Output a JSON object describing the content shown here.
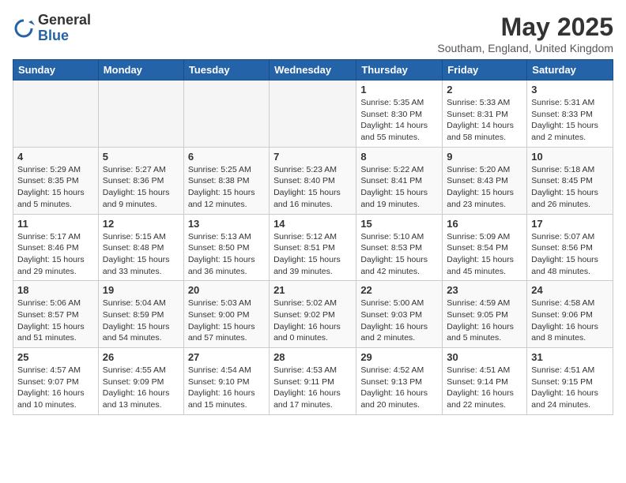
{
  "logo": {
    "general": "General",
    "blue": "Blue"
  },
  "title": "May 2025",
  "subtitle": "Southam, England, United Kingdom",
  "weekdays": [
    "Sunday",
    "Monday",
    "Tuesday",
    "Wednesday",
    "Thursday",
    "Friday",
    "Saturday"
  ],
  "weeks": [
    [
      {
        "day": "",
        "info": ""
      },
      {
        "day": "",
        "info": ""
      },
      {
        "day": "",
        "info": ""
      },
      {
        "day": "",
        "info": ""
      },
      {
        "day": "1",
        "info": "Sunrise: 5:35 AM\nSunset: 8:30 PM\nDaylight: 14 hours\nand 55 minutes."
      },
      {
        "day": "2",
        "info": "Sunrise: 5:33 AM\nSunset: 8:31 PM\nDaylight: 14 hours\nand 58 minutes."
      },
      {
        "day": "3",
        "info": "Sunrise: 5:31 AM\nSunset: 8:33 PM\nDaylight: 15 hours\nand 2 minutes."
      }
    ],
    [
      {
        "day": "4",
        "info": "Sunrise: 5:29 AM\nSunset: 8:35 PM\nDaylight: 15 hours\nand 5 minutes."
      },
      {
        "day": "5",
        "info": "Sunrise: 5:27 AM\nSunset: 8:36 PM\nDaylight: 15 hours\nand 9 minutes."
      },
      {
        "day": "6",
        "info": "Sunrise: 5:25 AM\nSunset: 8:38 PM\nDaylight: 15 hours\nand 12 minutes."
      },
      {
        "day": "7",
        "info": "Sunrise: 5:23 AM\nSunset: 8:40 PM\nDaylight: 15 hours\nand 16 minutes."
      },
      {
        "day": "8",
        "info": "Sunrise: 5:22 AM\nSunset: 8:41 PM\nDaylight: 15 hours\nand 19 minutes."
      },
      {
        "day": "9",
        "info": "Sunrise: 5:20 AM\nSunset: 8:43 PM\nDaylight: 15 hours\nand 23 minutes."
      },
      {
        "day": "10",
        "info": "Sunrise: 5:18 AM\nSunset: 8:45 PM\nDaylight: 15 hours\nand 26 minutes."
      }
    ],
    [
      {
        "day": "11",
        "info": "Sunrise: 5:17 AM\nSunset: 8:46 PM\nDaylight: 15 hours\nand 29 minutes."
      },
      {
        "day": "12",
        "info": "Sunrise: 5:15 AM\nSunset: 8:48 PM\nDaylight: 15 hours\nand 33 minutes."
      },
      {
        "day": "13",
        "info": "Sunrise: 5:13 AM\nSunset: 8:50 PM\nDaylight: 15 hours\nand 36 minutes."
      },
      {
        "day": "14",
        "info": "Sunrise: 5:12 AM\nSunset: 8:51 PM\nDaylight: 15 hours\nand 39 minutes."
      },
      {
        "day": "15",
        "info": "Sunrise: 5:10 AM\nSunset: 8:53 PM\nDaylight: 15 hours\nand 42 minutes."
      },
      {
        "day": "16",
        "info": "Sunrise: 5:09 AM\nSunset: 8:54 PM\nDaylight: 15 hours\nand 45 minutes."
      },
      {
        "day": "17",
        "info": "Sunrise: 5:07 AM\nSunset: 8:56 PM\nDaylight: 15 hours\nand 48 minutes."
      }
    ],
    [
      {
        "day": "18",
        "info": "Sunrise: 5:06 AM\nSunset: 8:57 PM\nDaylight: 15 hours\nand 51 minutes."
      },
      {
        "day": "19",
        "info": "Sunrise: 5:04 AM\nSunset: 8:59 PM\nDaylight: 15 hours\nand 54 minutes."
      },
      {
        "day": "20",
        "info": "Sunrise: 5:03 AM\nSunset: 9:00 PM\nDaylight: 15 hours\nand 57 minutes."
      },
      {
        "day": "21",
        "info": "Sunrise: 5:02 AM\nSunset: 9:02 PM\nDaylight: 16 hours\nand 0 minutes."
      },
      {
        "day": "22",
        "info": "Sunrise: 5:00 AM\nSunset: 9:03 PM\nDaylight: 16 hours\nand 2 minutes."
      },
      {
        "day": "23",
        "info": "Sunrise: 4:59 AM\nSunset: 9:05 PM\nDaylight: 16 hours\nand 5 minutes."
      },
      {
        "day": "24",
        "info": "Sunrise: 4:58 AM\nSunset: 9:06 PM\nDaylight: 16 hours\nand 8 minutes."
      }
    ],
    [
      {
        "day": "25",
        "info": "Sunrise: 4:57 AM\nSunset: 9:07 PM\nDaylight: 16 hours\nand 10 minutes."
      },
      {
        "day": "26",
        "info": "Sunrise: 4:55 AM\nSunset: 9:09 PM\nDaylight: 16 hours\nand 13 minutes."
      },
      {
        "day": "27",
        "info": "Sunrise: 4:54 AM\nSunset: 9:10 PM\nDaylight: 16 hours\nand 15 minutes."
      },
      {
        "day": "28",
        "info": "Sunrise: 4:53 AM\nSunset: 9:11 PM\nDaylight: 16 hours\nand 17 minutes."
      },
      {
        "day": "29",
        "info": "Sunrise: 4:52 AM\nSunset: 9:13 PM\nDaylight: 16 hours\nand 20 minutes."
      },
      {
        "day": "30",
        "info": "Sunrise: 4:51 AM\nSunset: 9:14 PM\nDaylight: 16 hours\nand 22 minutes."
      },
      {
        "day": "31",
        "info": "Sunrise: 4:51 AM\nSunset: 9:15 PM\nDaylight: 16 hours\nand 24 minutes."
      }
    ]
  ]
}
